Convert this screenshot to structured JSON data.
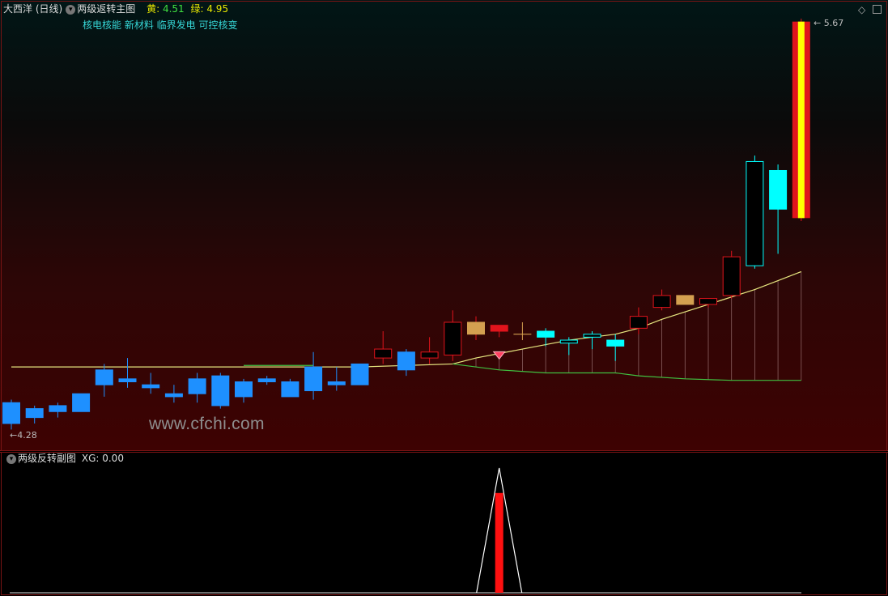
{
  "header": {
    "stock_name": "大西洋",
    "period": "(日线)",
    "indicator_name": "两级返转主图",
    "yellow_label": "黄:",
    "yellow_value": "4.51",
    "green_label": "绿:",
    "green_value": "4.95",
    "concepts": "核电核能 新材料 临界发电 可控核变"
  },
  "price_labels": {
    "high": "5.67",
    "low": "4.28"
  },
  "watermark": "www.cfchi.com",
  "sub_header": {
    "indicator_name": "两级反转副图",
    "xg_label": "XG:",
    "xg_value": "0.00"
  },
  "colors": {
    "bull": "#e0141c",
    "bear_blue": "#1e90ff",
    "bear_cyan": "#00ffff",
    "gold": "#d4a050",
    "yellow_line": "#e8e880",
    "green_line": "#40c040"
  },
  "chart_data": {
    "type": "candlestick",
    "price_range": [
      4.28,
      5.67
    ],
    "candles": [
      {
        "o": 4.38,
        "c": 4.31,
        "h": 4.39,
        "l": 4.29,
        "style": "blue"
      },
      {
        "o": 4.36,
        "c": 4.33,
        "h": 4.37,
        "l": 4.31,
        "style": "blue"
      },
      {
        "o": 4.37,
        "c": 4.35,
        "h": 4.38,
        "l": 4.33,
        "style": "blue"
      },
      {
        "o": 4.41,
        "c": 4.35,
        "h": 4.41,
        "l": 4.35,
        "style": "blue"
      },
      {
        "o": 4.49,
        "c": 4.44,
        "h": 4.51,
        "l": 4.4,
        "style": "blue"
      },
      {
        "o": 4.46,
        "c": 4.45,
        "h": 4.53,
        "l": 4.43,
        "style": "blue"
      },
      {
        "o": 4.44,
        "c": 4.43,
        "h": 4.48,
        "l": 4.41,
        "style": "blue"
      },
      {
        "o": 4.41,
        "c": 4.4,
        "h": 4.44,
        "l": 4.38,
        "style": "blue"
      },
      {
        "o": 4.46,
        "c": 4.41,
        "h": 4.48,
        "l": 4.38,
        "style": "blue"
      },
      {
        "o": 4.47,
        "c": 4.37,
        "h": 4.48,
        "l": 4.36,
        "style": "blue"
      },
      {
        "o": 4.45,
        "c": 4.4,
        "h": 4.46,
        "l": 4.38,
        "style": "blue"
      },
      {
        "o": 4.46,
        "c": 4.45,
        "h": 4.47,
        "l": 4.44,
        "style": "blue"
      },
      {
        "o": 4.45,
        "c": 4.4,
        "h": 4.46,
        "l": 4.4,
        "style": "blue"
      },
      {
        "o": 4.5,
        "c": 4.42,
        "h": 4.55,
        "l": 4.39,
        "style": "blue"
      },
      {
        "o": 4.45,
        "c": 4.44,
        "h": 4.5,
        "l": 4.42,
        "style": "blue"
      },
      {
        "o": 4.51,
        "c": 4.44,
        "h": 4.51,
        "l": 4.44,
        "style": "blue"
      },
      {
        "o": 4.53,
        "c": 4.56,
        "h": 4.62,
        "l": 4.51,
        "style": "red"
      },
      {
        "o": 4.55,
        "c": 4.49,
        "h": 4.56,
        "l": 4.47,
        "style": "blue"
      },
      {
        "o": 4.53,
        "c": 4.55,
        "h": 4.6,
        "l": 4.51,
        "style": "red"
      },
      {
        "o": 4.54,
        "c": 4.65,
        "h": 4.69,
        "l": 4.52,
        "style": "red"
      },
      {
        "o": 4.65,
        "c": 4.61,
        "h": 4.67,
        "l": 4.59,
        "style": "gold"
      },
      {
        "o": 4.64,
        "c": 4.62,
        "h": 4.64,
        "l": 4.6,
        "style": "red_solid"
      },
      {
        "o": 4.61,
        "c": 4.61,
        "h": 4.65,
        "l": 4.59,
        "style": "gold_doji"
      },
      {
        "o": 4.62,
        "c": 4.6,
        "h": 4.63,
        "l": 4.57,
        "style": "cyan"
      },
      {
        "o": 4.59,
        "c": 4.58,
        "h": 4.6,
        "l": 4.54,
        "style": "cyan_hollow"
      },
      {
        "o": 4.61,
        "c": 4.6,
        "h": 4.62,
        "l": 4.56,
        "style": "cyan_hollow"
      },
      {
        "o": 4.59,
        "c": 4.57,
        "h": 4.61,
        "l": 4.52,
        "style": "cyan"
      },
      {
        "o": 4.63,
        "c": 4.67,
        "h": 4.7,
        "l": 4.61,
        "style": "red"
      },
      {
        "o": 4.7,
        "c": 4.74,
        "h": 4.76,
        "l": 4.69,
        "style": "red"
      },
      {
        "o": 4.74,
        "c": 4.71,
        "h": 4.74,
        "l": 4.71,
        "style": "gold"
      },
      {
        "o": 4.71,
        "c": 4.73,
        "h": 4.73,
        "l": 4.7,
        "style": "red"
      },
      {
        "o": 4.74,
        "c": 4.87,
        "h": 4.89,
        "l": 4.73,
        "style": "red"
      },
      {
        "o": 4.84,
        "c": 5.19,
        "h": 5.21,
        "l": 4.83,
        "style": "cyan_hollow"
      },
      {
        "o": 5.16,
        "c": 5.03,
        "h": 5.18,
        "l": 4.88,
        "style": "cyan"
      },
      {
        "o": 5.0,
        "c": 5.66,
        "h": 5.67,
        "l": 4.99,
        "style": "limit_up"
      }
    ],
    "yellow_line": [
      {
        "i": 0,
        "v": 4.5
      },
      {
        "i": 15,
        "v": 4.5
      },
      {
        "i": 19,
        "v": 4.51
      },
      {
        "i": 20,
        "v": 4.53
      },
      {
        "i": 22,
        "v": 4.56
      },
      {
        "i": 24,
        "v": 4.59
      },
      {
        "i": 26,
        "v": 4.61
      },
      {
        "i": 27,
        "v": 4.63
      },
      {
        "i": 28,
        "v": 4.66
      },
      {
        "i": 30,
        "v": 4.71
      },
      {
        "i": 32,
        "v": 4.76
      },
      {
        "i": 33,
        "v": 4.79
      },
      {
        "i": 34,
        "v": 4.82
      }
    ],
    "green_line": [
      {
        "i": 19,
        "v": 4.51
      },
      {
        "i": 21,
        "v": 4.49
      },
      {
        "i": 23,
        "v": 4.48
      },
      {
        "i": 26,
        "v": 4.48
      },
      {
        "i": 27,
        "v": 4.47
      },
      {
        "i": 29,
        "v": 4.46
      },
      {
        "i": 31,
        "v": 4.455
      },
      {
        "i": 34,
        "v": 4.455
      }
    ],
    "green_segment_early": [
      {
        "i": 10,
        "v": 4.505
      },
      {
        "i": 13,
        "v": 4.505
      }
    ],
    "signal_index": 21,
    "sub_signal": {
      "index": 21,
      "value": 1,
      "bar_value": 0.8
    }
  }
}
